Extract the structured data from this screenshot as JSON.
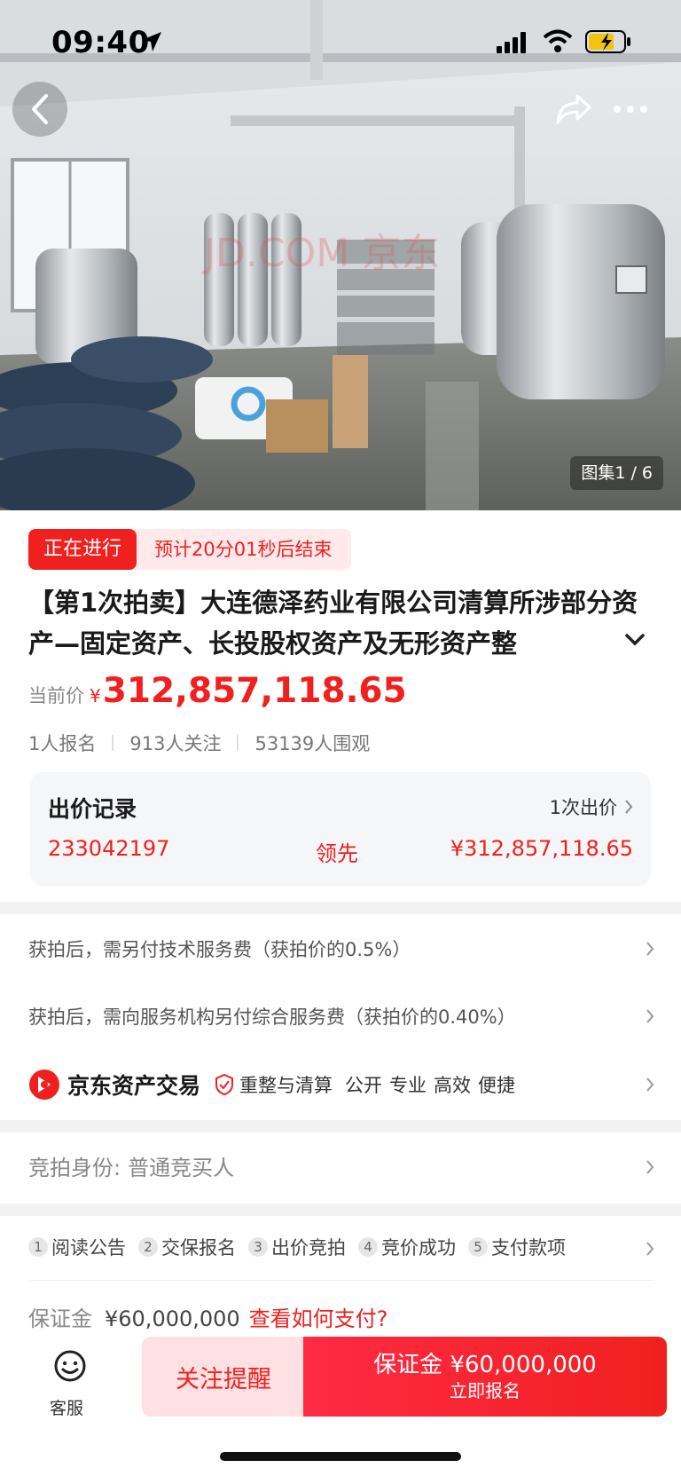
{
  "status_bar": {
    "time": "09:40"
  },
  "hero": {
    "gallery_label": "图集1 / 6",
    "watermark": "JD.COM 京东"
  },
  "auction": {
    "status_tag": "正在进行",
    "countdown": "预计20分01秒后结束",
    "title": "【第1次拍卖】大连德泽药业有限公司清算所涉部分资产—固定资产、长投股权资产及无形资产整",
    "price_label": "当前价",
    "price_symbol": "¥",
    "price_value": "312,857,118.65",
    "stats": {
      "signups": "1人报名",
      "followers": "913人关注",
      "viewers": "53139人围观"
    }
  },
  "bid_record": {
    "title": "出价记录",
    "count": "1次出价",
    "user": "233042197",
    "state": "领先",
    "price": "¥312,857,118.65"
  },
  "fees": {
    "tech_fee": "获拍后，需另付技术服务费（获拍价的0.5%）",
    "service_fee": "获拍后，需向服务机构另付综合服务费（获拍价的0.40%）"
  },
  "platform": {
    "brand": "京东资产交易",
    "tag": "重整与清算",
    "slogans": [
      "公开",
      "专业",
      "高效",
      "便捷"
    ]
  },
  "identity": {
    "label": "竞拍身份:",
    "value": "普通竞买人"
  },
  "steps": [
    {
      "num": "1",
      "label": "阅读公告"
    },
    {
      "num": "2",
      "label": "交保报名"
    },
    {
      "num": "3",
      "label": "出价竞拍"
    },
    {
      "num": "4",
      "label": "竞价成功"
    },
    {
      "num": "5",
      "label": "支付款项"
    }
  ],
  "deposit": {
    "label": "保证金",
    "value": "¥60,000,000",
    "link": "查看如何支付?"
  },
  "bottom": {
    "cs_label": "客服",
    "follow_label": "关注提醒",
    "signup_main": "保证金 ¥60,000,000",
    "signup_sub": "立即报名"
  },
  "colors": {
    "accent": "#f0201f",
    "accent_light": "#ffe1e4"
  }
}
